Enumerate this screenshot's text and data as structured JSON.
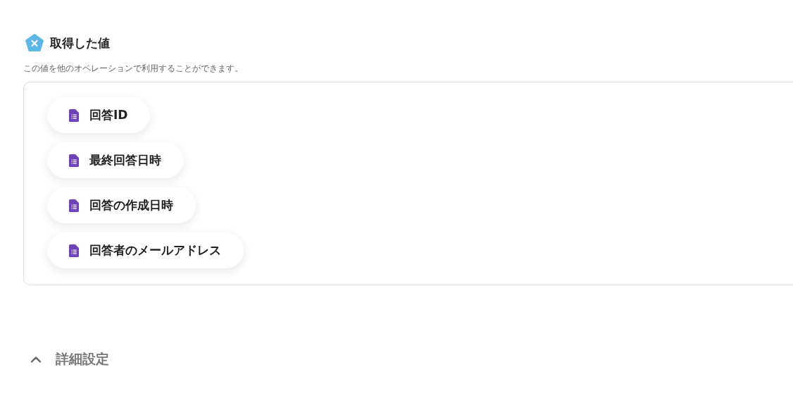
{
  "section": {
    "title": "取得した値",
    "description": "この値を他のオペレーションで利用することができます。"
  },
  "values": [
    {
      "label": "回答ID"
    },
    {
      "label": "最終回答日時"
    },
    {
      "label": "回答の作成日時"
    },
    {
      "label": "回答者のメールアドレス"
    }
  ],
  "advanced": {
    "label": "詳細設定",
    "expanded": true
  }
}
